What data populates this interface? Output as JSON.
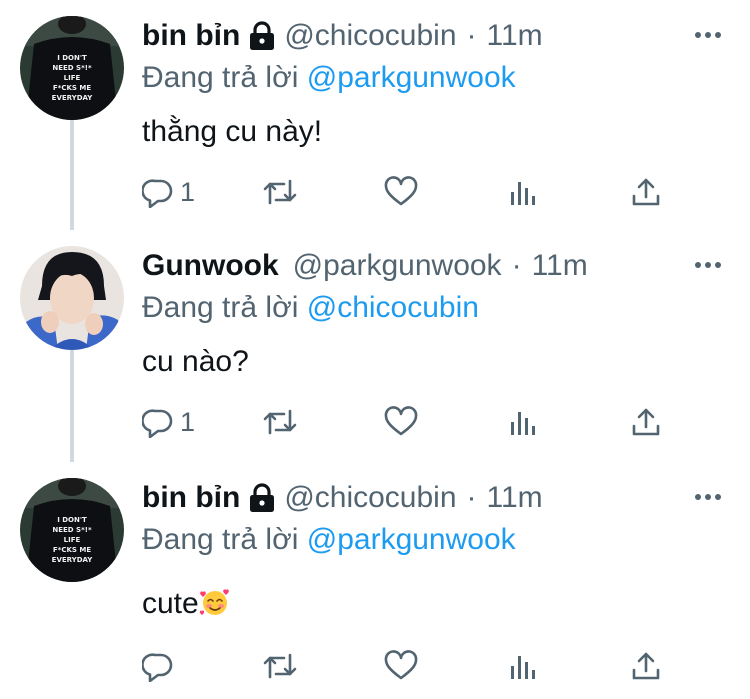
{
  "tweets": [
    {
      "display_name": "bin bỉn",
      "protected_icon": "lock-icon",
      "handle": "@chicocubin",
      "separator": "·",
      "time": "11m",
      "reply_prefix": "Đang trả lời",
      "reply_mention": "@parkgunwook",
      "text": "thằng cu này!",
      "reply_count": "1",
      "avatar": "shirt-with-text-avatar",
      "shirt_text": [
        "I DON'T",
        "NEED S*!*",
        "LIFE",
        "F*CKS ME",
        "EVERYDAY"
      ]
    },
    {
      "display_name": "Gunwook",
      "handle": "@parkgunwook",
      "separator": "·",
      "time": "11m",
      "reply_prefix": "Đang trả lời",
      "reply_mention": "@chicocubin",
      "text": "cu nào?",
      "reply_count": "1",
      "avatar": "person-selfie-avatar"
    },
    {
      "display_name": "bin bỉn",
      "protected_icon": "lock-icon",
      "handle": "@chicocubin",
      "separator": "·",
      "time": "11m",
      "reply_prefix": "Đang trả lời",
      "reply_mention": "@parkgunwook",
      "text": "cute",
      "emoji": "smiling-face-with-hearts",
      "reply_count": "",
      "avatar": "shirt-with-text-avatar",
      "shirt_text": [
        "I DON'T",
        "NEED S*!*",
        "LIFE",
        "F*CKS ME",
        "EVERYDAY"
      ]
    }
  ],
  "action_icons": [
    "reply-icon",
    "retweet-icon",
    "like-icon",
    "analytics-icon",
    "share-icon"
  ],
  "colors": {
    "text_primary": "#0f1419",
    "text_secondary": "#536471",
    "mention": "#1d9bf0",
    "thread_line": "#cfd9de"
  }
}
